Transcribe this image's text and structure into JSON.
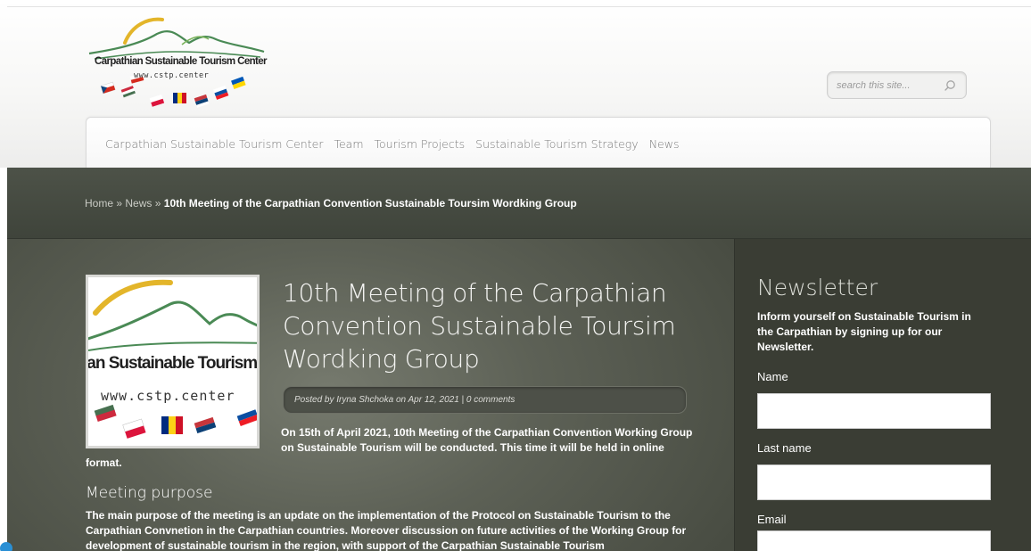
{
  "header": {
    "logo": {
      "name": "Carpathian Sustainable Tourism Center",
      "url": "www.cstp.center"
    },
    "search": {
      "placeholder": "search this site..."
    },
    "nav": [
      "Carpathian Sustainable Tourism Center",
      "Team",
      "Tourism Projects",
      "Sustainable Tourism Strategy",
      "News"
    ]
  },
  "breadcrumb": {
    "home": "Home",
    "separator": "»",
    "news": "News",
    "current": "10th Meeting of the Carpathian Convention Sustainable Toursim Wordking Group"
  },
  "post": {
    "thumbnail": {
      "text": "ian Sustainable Tourism",
      "url": "www.cstp.center"
    },
    "title": "10th Meeting of the Carpathian Convention Sustainable Toursim Wordking Group",
    "meta": "Posted by Iryna Shchoka on Apr 12, 2021 | 0 comments",
    "intro": "On 15th of April 2021, 10th Meeting of the Carpathian Convention Working Group on Sustainable Tourism will be conducted. This time it will be held in online format.",
    "subheading": "Meeting purpose",
    "body": "The main purpose of the meeting is an update on the implementation of the Protocol on Sustainable Tourism to the Carpathian Convnetion in the Carpathian countries. Moreover discussion on future activities of the Working Group for development of sustainable tourism in the region, with support of the Carpathian Sustainable Tourism"
  },
  "sidebar": {
    "newsletter": {
      "title": "Newsletter",
      "description": "Inform yourself on Sustainable Tourism in the Carpathian by signing up for our Newsletter.",
      "fields": [
        "Name",
        "Last name",
        "Email"
      ]
    }
  },
  "colors": {
    "band": "#484c42",
    "sidebar": "#3a3d34",
    "logo_green": "#4a8a55",
    "logo_sun": "#e3b52a"
  }
}
